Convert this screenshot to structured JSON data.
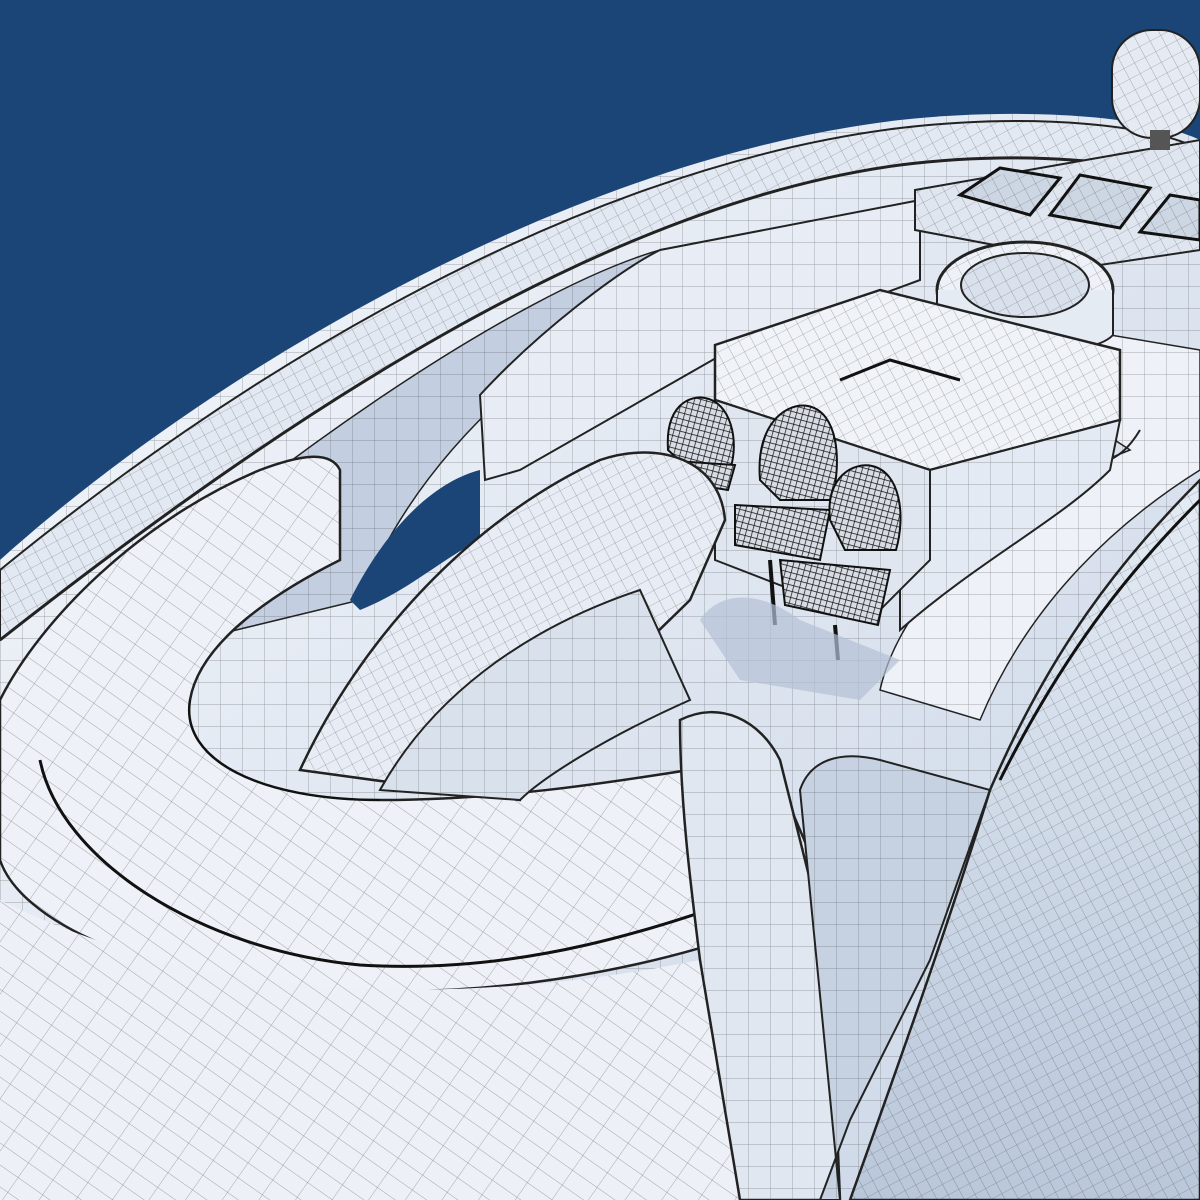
{
  "scene": {
    "colors": {
      "sky": "#1c4577",
      "hull": "#eef2f8",
      "hull_shade": "#c4d0e0",
      "wire": "#3a3a3a",
      "seat": "#2a2a2a",
      "shadow": "#aebdd2"
    },
    "objects": [
      "hull",
      "side-deck-bulwark",
      "bow-loop",
      "center-console",
      "radar-dome",
      "windshield",
      "jacuzzi-ring",
      "seat-row",
      "aft-deck"
    ]
  }
}
